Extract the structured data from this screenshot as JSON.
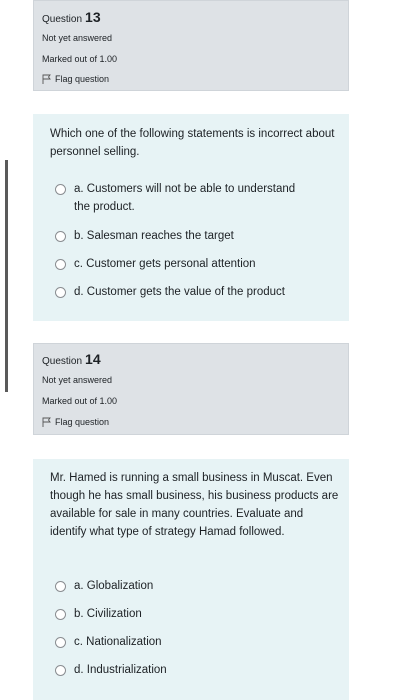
{
  "q13": {
    "question_label": "Question",
    "number": "13",
    "state": "Not yet answered",
    "grade": "Marked out of 1.00",
    "flag_label": "Flag question",
    "text": "Which one of the following statements is incorrect about personnel selling.",
    "options": [
      "a. Customers will not be able to understand the product.",
      "b. Salesman reaches the target",
      "c. Customer gets personal attention",
      "d. Customer gets the value of the product"
    ]
  },
  "q14": {
    "question_label": "Question",
    "number": "14",
    "state": "Not yet answered",
    "grade": "Marked out of 1.00",
    "flag_label": "Flag question",
    "text": "Mr. Hamed is running a small business in Muscat. Even though he has small business, his business products are available for sale in many countries. Evaluate and identify what type of strategy Hamad followed.",
    "options": [
      "a. Globalization",
      "b. Civilization",
      "c. Nationalization",
      "d. Industrialization"
    ]
  }
}
